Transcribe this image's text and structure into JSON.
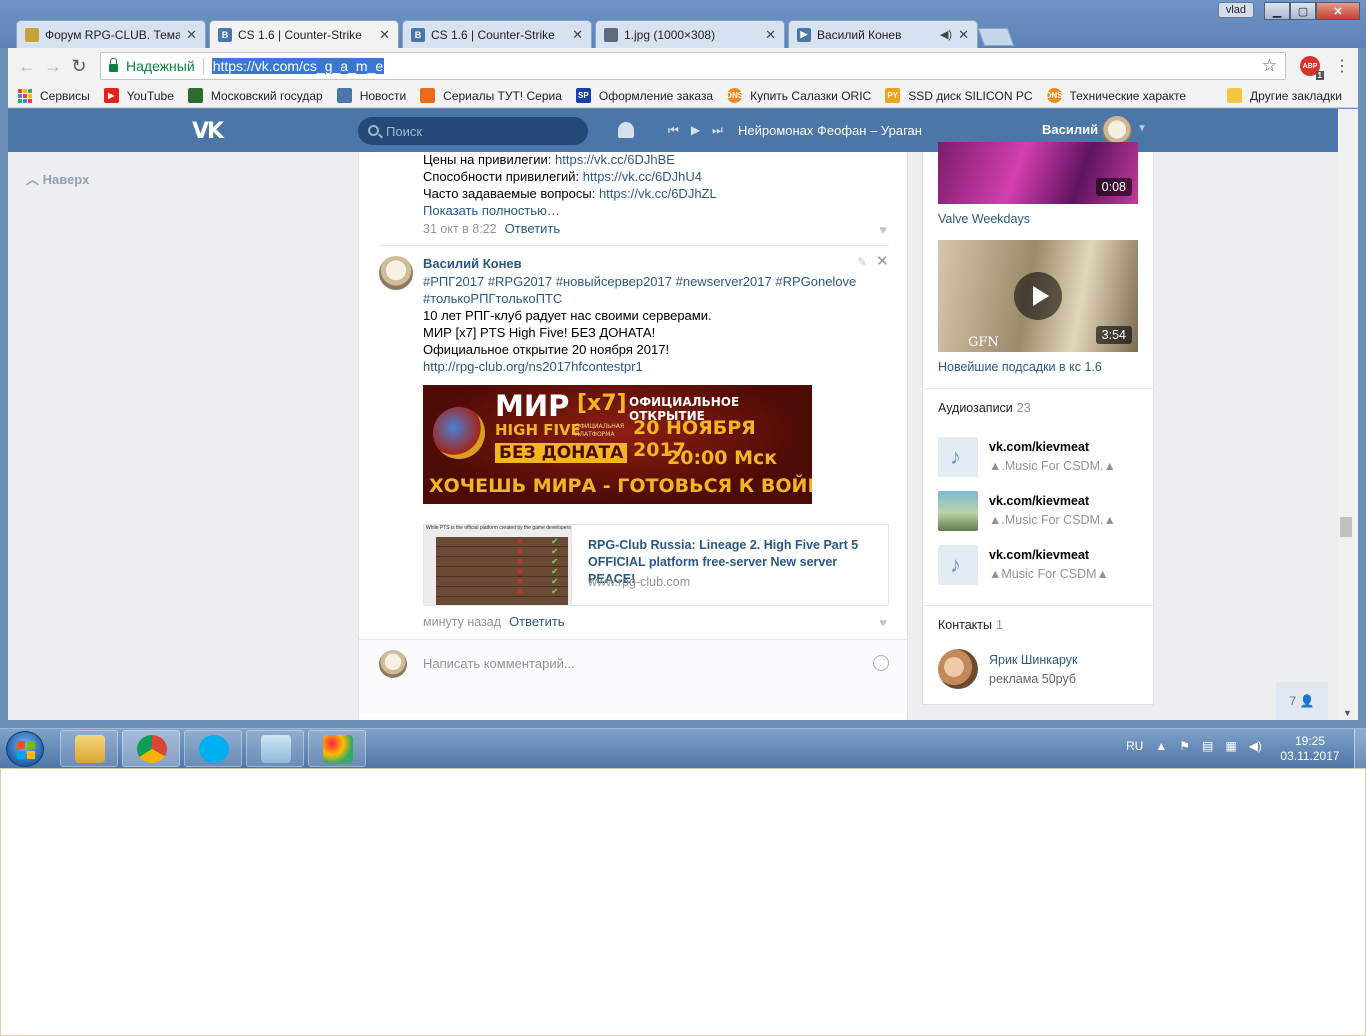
{
  "browser": {
    "user_badge": "vlad",
    "tabs": [
      {
        "title": "Форум RPG-CLUB. Тема",
        "icon": "rpg-club-icon",
        "color": "#c8a23a"
      },
      {
        "title": "CS 1.6 | Counter-Strike",
        "icon": "vk-icon",
        "color": "#4a76a8",
        "active": true
      },
      {
        "title": "CS 1.6 | Counter-Strike",
        "icon": "vk-icon",
        "color": "#4a76a8"
      },
      {
        "title": "1.jpg (1000×308)",
        "icon": "image-icon",
        "color": "#5b6b7b"
      },
      {
        "title": "Василий Конев",
        "icon": "vk-icon",
        "color": "#4a76a8",
        "audio": true
      }
    ],
    "secure_label": "Надежный",
    "url": "https://vk.com/cs_g_a_m_e",
    "ext_badge": "ABP",
    "ext_count": "1",
    "bookmarks": [
      {
        "label": "Сервисы"
      },
      {
        "label": "YouTube",
        "color": "#e62117"
      },
      {
        "label": "Московский государ",
        "color": "#2e6b2e"
      },
      {
        "label": "Новости",
        "color": "#4a76a8"
      },
      {
        "label": "Сериалы ТУТ! Сериа",
        "color": "#e86a1a"
      },
      {
        "label": "Оформление заказа",
        "color": "#1a3fa8",
        "badge": "SP"
      },
      {
        "label": "Купить Салазки ORIC",
        "color": "#f08a1c",
        "badge": "DNS"
      },
      {
        "label": "SSD диск SILICON PC",
        "color": "#f0a21c",
        "badge": "PY"
      },
      {
        "label": "Технические характе",
        "color": "#f08a1c",
        "badge": "DNS"
      }
    ],
    "other_bookmarks": "Другие закладки"
  },
  "vk": {
    "search_placeholder": "Поиск",
    "now_playing": "Нейромонах Феофан – Ураган",
    "user_name": "Василий",
    "scroll_up": "Наверх",
    "post1": {
      "lines": [
        {
          "label": "Цены на привилегии: ",
          "link": "https://vk.cc/6DJhBE"
        },
        {
          "label": "Способности привилегий: ",
          "link": "https://vk.cc/6DJhU4"
        },
        {
          "label": "Часто задаваемые вопросы: ",
          "link": "https://vk.cc/6DJhZL"
        }
      ],
      "show_more": "Показать полностью…",
      "time": "31 окт в 8:22",
      "reply": "Ответить"
    },
    "post2": {
      "author": "Василий Конев",
      "hashtags1": "#РПГ2017 #RPG2017 #новыйсервер2017 #newserver2017 #RPGonelove",
      "hashtags2": "#толькоРПГтолькоПТС",
      "text1": "10 лет РПГ-клуб радует нас своими серверами.",
      "text2": "МИР [x7] PTS High Five! БЕЗ ДОНАТА!",
      "text3": "Официальное открытие 20 ноября 2017!",
      "link": "http://rpg-club.org/ns2017hfcontestpr1",
      "banner": {
        "l1": "МИР",
        "l2": "[x7]",
        "l3": "HIGH FIVE",
        "l4": "ОФИЦИАЛЬНАЯ ПЛАТФОРМА",
        "l5": "БЕЗ ДОНАТА",
        "l6": "ОФИЦИАЛЬНОЕ ОТКРЫТИЕ",
        "l7": "20 НОЯБРЯ 2017",
        "l8": "20:00 Мск",
        "l9": "ХОЧЕШЬ МИРА - ГОТОВЬСЯ К ВОЙНЕ"
      },
      "snippet": {
        "thumb_caption": "While PTS is the official platform created by the game developers",
        "title": "RPG-Club Russia: Lineage 2. High Five Part 5 OFFICIAL platform free-server New server PEACE!",
        "domain": "www.rpg-club.com"
      },
      "time": "минуту назад",
      "reply": "Ответить"
    },
    "comment_placeholder": "Написать комментарий...",
    "videos": [
      {
        "title": "Valve Weekdays",
        "duration": "0:08"
      },
      {
        "title": "Новейшие подсадки в кс 1.6",
        "duration": "3:54",
        "watermark": "GFN"
      }
    ],
    "audio_header": "Аудиозаписи",
    "audio_count": "23",
    "tracks": [
      {
        "artist": "vk.com/kievmeat",
        "title": "▲.Music For CSDM.▲"
      },
      {
        "artist": "vk.com/kievmeat",
        "title": "▲.Music For CSDM.▲"
      },
      {
        "artist": "vk.com/kievmeat",
        "title": "▲Music For CSDM▲"
      }
    ],
    "contacts_header": "Контакты",
    "contacts_count": "1",
    "contact": {
      "name": "Ярик Шинкарук",
      "sub": "реклама 50руб"
    },
    "friends_online": "7"
  },
  "taskbar": {
    "lang": "RU",
    "time": "19:25",
    "date": "03.11.2017"
  }
}
